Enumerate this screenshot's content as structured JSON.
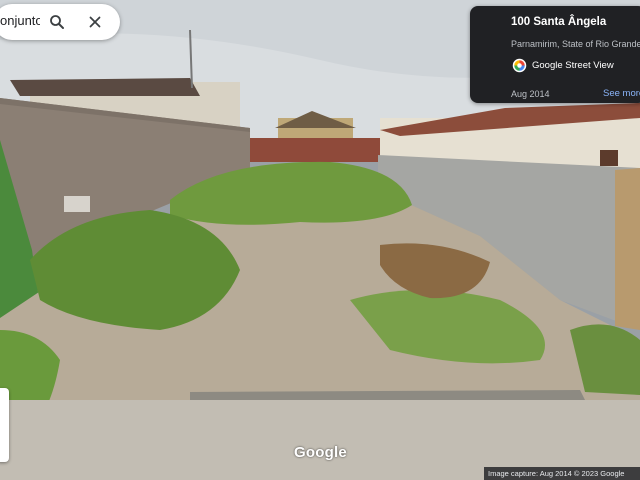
{
  "search": {
    "query": "onjunto Pi",
    "search_icon": "search-icon",
    "close_icon": "close-icon"
  },
  "info_card": {
    "title": "100 Santa Ângela",
    "subtitle": "Parnamirim, State of Rio Grande d",
    "service_label": "Google Street View",
    "service_icon": "street-view-logo",
    "date": "Aug 2014",
    "more_link": "See more"
  },
  "footer": {
    "logo": "Google",
    "capture_text": "Image capture: Aug 2014   © 2023 Google"
  },
  "colors": {
    "card_bg": "#202124",
    "link": "#8ab4f8",
    "sky": "#cfd4d8",
    "vegetation": "#6f9a3e",
    "wall": "#a5a6a3",
    "brick": "#8b7f74",
    "green_wall": "#4b8a3c"
  }
}
